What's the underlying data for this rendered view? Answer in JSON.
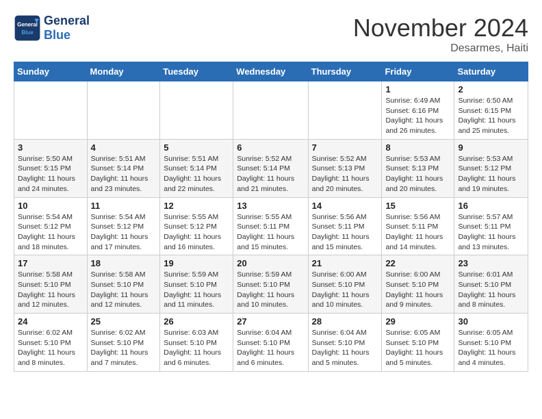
{
  "header": {
    "logo_general": "General",
    "logo_blue": "Blue",
    "month_title": "November 2024",
    "location": "Desarmes, Haiti"
  },
  "days_of_week": [
    "Sunday",
    "Monday",
    "Tuesday",
    "Wednesday",
    "Thursday",
    "Friday",
    "Saturday"
  ],
  "weeks": [
    [
      {
        "day": "",
        "detail": ""
      },
      {
        "day": "",
        "detail": ""
      },
      {
        "day": "",
        "detail": ""
      },
      {
        "day": "",
        "detail": ""
      },
      {
        "day": "",
        "detail": ""
      },
      {
        "day": "1",
        "detail": "Sunrise: 6:49 AM\nSunset: 6:16 PM\nDaylight: 11 hours and 26 minutes."
      },
      {
        "day": "2",
        "detail": "Sunrise: 6:50 AM\nSunset: 6:15 PM\nDaylight: 11 hours and 25 minutes."
      }
    ],
    [
      {
        "day": "3",
        "detail": "Sunrise: 5:50 AM\nSunset: 5:15 PM\nDaylight: 11 hours and 24 minutes."
      },
      {
        "day": "4",
        "detail": "Sunrise: 5:51 AM\nSunset: 5:14 PM\nDaylight: 11 hours and 23 minutes."
      },
      {
        "day": "5",
        "detail": "Sunrise: 5:51 AM\nSunset: 5:14 PM\nDaylight: 11 hours and 22 minutes."
      },
      {
        "day": "6",
        "detail": "Sunrise: 5:52 AM\nSunset: 5:14 PM\nDaylight: 11 hours and 21 minutes."
      },
      {
        "day": "7",
        "detail": "Sunrise: 5:52 AM\nSunset: 5:13 PM\nDaylight: 11 hours and 20 minutes."
      },
      {
        "day": "8",
        "detail": "Sunrise: 5:53 AM\nSunset: 5:13 PM\nDaylight: 11 hours and 20 minutes."
      },
      {
        "day": "9",
        "detail": "Sunrise: 5:53 AM\nSunset: 5:12 PM\nDaylight: 11 hours and 19 minutes."
      }
    ],
    [
      {
        "day": "10",
        "detail": "Sunrise: 5:54 AM\nSunset: 5:12 PM\nDaylight: 11 hours and 18 minutes."
      },
      {
        "day": "11",
        "detail": "Sunrise: 5:54 AM\nSunset: 5:12 PM\nDaylight: 11 hours and 17 minutes."
      },
      {
        "day": "12",
        "detail": "Sunrise: 5:55 AM\nSunset: 5:12 PM\nDaylight: 11 hours and 16 minutes."
      },
      {
        "day": "13",
        "detail": "Sunrise: 5:55 AM\nSunset: 5:11 PM\nDaylight: 11 hours and 15 minutes."
      },
      {
        "day": "14",
        "detail": "Sunrise: 5:56 AM\nSunset: 5:11 PM\nDaylight: 11 hours and 15 minutes."
      },
      {
        "day": "15",
        "detail": "Sunrise: 5:56 AM\nSunset: 5:11 PM\nDaylight: 11 hours and 14 minutes."
      },
      {
        "day": "16",
        "detail": "Sunrise: 5:57 AM\nSunset: 5:11 PM\nDaylight: 11 hours and 13 minutes."
      }
    ],
    [
      {
        "day": "17",
        "detail": "Sunrise: 5:58 AM\nSunset: 5:10 PM\nDaylight: 11 hours and 12 minutes."
      },
      {
        "day": "18",
        "detail": "Sunrise: 5:58 AM\nSunset: 5:10 PM\nDaylight: 11 hours and 12 minutes."
      },
      {
        "day": "19",
        "detail": "Sunrise: 5:59 AM\nSunset: 5:10 PM\nDaylight: 11 hours and 11 minutes."
      },
      {
        "day": "20",
        "detail": "Sunrise: 5:59 AM\nSunset: 5:10 PM\nDaylight: 11 hours and 10 minutes."
      },
      {
        "day": "21",
        "detail": "Sunrise: 6:00 AM\nSunset: 5:10 PM\nDaylight: 11 hours and 10 minutes."
      },
      {
        "day": "22",
        "detail": "Sunrise: 6:00 AM\nSunset: 5:10 PM\nDaylight: 11 hours and 9 minutes."
      },
      {
        "day": "23",
        "detail": "Sunrise: 6:01 AM\nSunset: 5:10 PM\nDaylight: 11 hours and 8 minutes."
      }
    ],
    [
      {
        "day": "24",
        "detail": "Sunrise: 6:02 AM\nSunset: 5:10 PM\nDaylight: 11 hours and 8 minutes."
      },
      {
        "day": "25",
        "detail": "Sunrise: 6:02 AM\nSunset: 5:10 PM\nDaylight: 11 hours and 7 minutes."
      },
      {
        "day": "26",
        "detail": "Sunrise: 6:03 AM\nSunset: 5:10 PM\nDaylight: 11 hours and 6 minutes."
      },
      {
        "day": "27",
        "detail": "Sunrise: 6:04 AM\nSunset: 5:10 PM\nDaylight: 11 hours and 6 minutes."
      },
      {
        "day": "28",
        "detail": "Sunrise: 6:04 AM\nSunset: 5:10 PM\nDaylight: 11 hours and 5 minutes."
      },
      {
        "day": "29",
        "detail": "Sunrise: 6:05 AM\nSunset: 5:10 PM\nDaylight: 11 hours and 5 minutes."
      },
      {
        "day": "30",
        "detail": "Sunrise: 6:05 AM\nSunset: 5:10 PM\nDaylight: 11 hours and 4 minutes."
      }
    ]
  ]
}
